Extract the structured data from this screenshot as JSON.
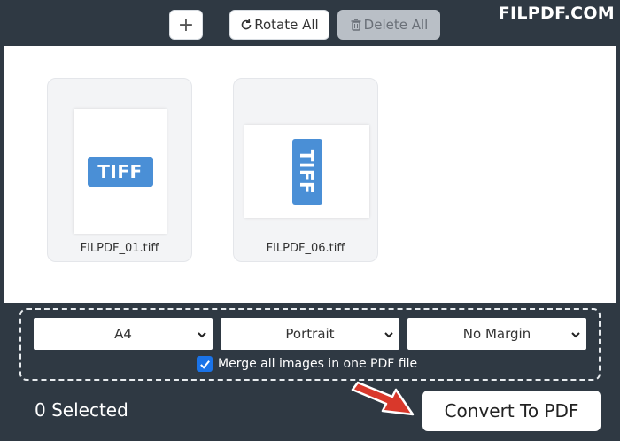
{
  "toolbar": {
    "add_icon": "plus-icon",
    "rotate_label": "Rotate All",
    "rotate_icon": "rotate-icon",
    "delete_label": "Delete All",
    "delete_icon": "trash-icon"
  },
  "watermark": "FILPDF.COM",
  "files": [
    {
      "badge": "TIFF",
      "name": "FILPDF_01.tiff",
      "orientation": "portrait"
    },
    {
      "badge": "TIFF",
      "name": "FILPDF_06.tiff",
      "orientation": "landscape"
    }
  ],
  "options": {
    "page_size": "A4",
    "orientation": "Portrait",
    "margin": "No Margin",
    "merge_checked": true,
    "merge_label": "Merge all images in one PDF file"
  },
  "footer": {
    "selected_text": "0 Selected",
    "convert_label": "Convert To PDF"
  },
  "colors": {
    "background": "#2f3943",
    "badge": "#4a8fd6",
    "checkbox": "#1a73e8",
    "arrow": "#d9382b"
  }
}
